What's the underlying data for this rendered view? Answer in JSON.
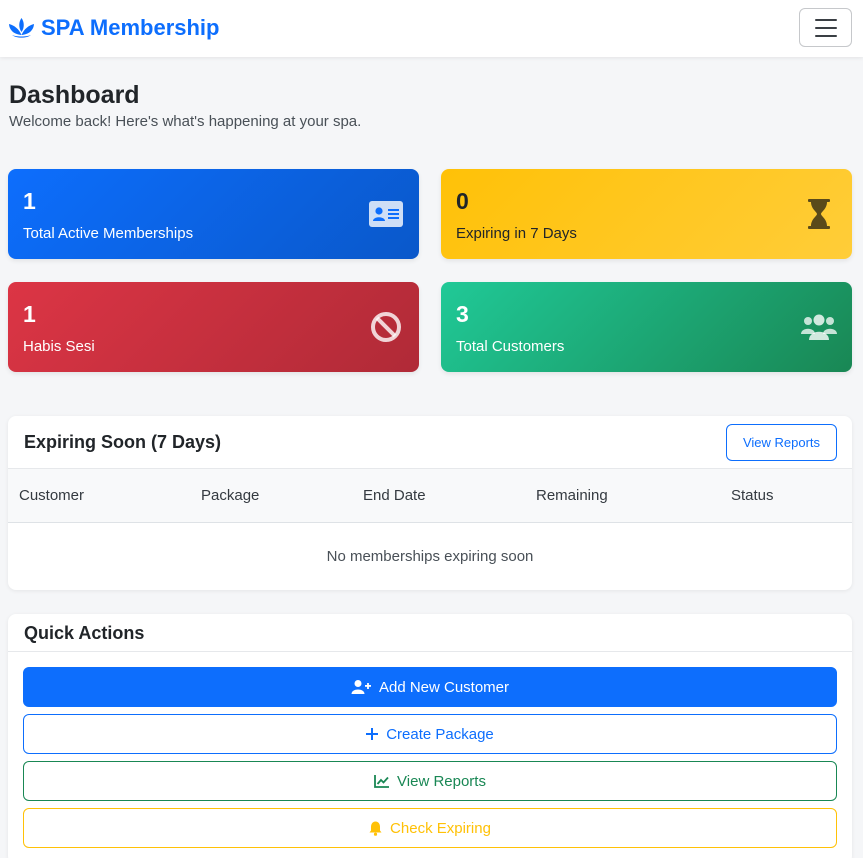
{
  "navbar": {
    "brand_label": "SPA Membership",
    "brand_icon": "spa-lotus-icon",
    "toggler_icon": "hamburger-menu-icon"
  },
  "header": {
    "title": "Dashboard",
    "subtitle": "Welcome back! Here's what's happening at your spa."
  },
  "stats": [
    {
      "value": "1",
      "label": "Total Active Memberships",
      "icon": "id-card-icon",
      "color": "#0d6efd"
    },
    {
      "value": "0",
      "label": "Expiring in 7 Days",
      "icon": "hourglass-icon",
      "color": "#ffc107"
    },
    {
      "value": "1",
      "label": "Habis Sesi",
      "icon": "ban-icon",
      "color": "#dc3545"
    },
    {
      "value": "3",
      "label": "Total Customers",
      "icon": "users-icon",
      "color": "#20c997"
    }
  ],
  "expiring": {
    "title": "Expiring Soon (7 Days)",
    "view_reports_label": "View Reports",
    "columns": [
      "Customer",
      "Package",
      "End Date",
      "Remaining",
      "Status"
    ],
    "empty_message": "No memberships expiring soon"
  },
  "quick_actions": {
    "title": "Quick Actions",
    "buttons": [
      {
        "label": "Add New Customer",
        "icon": "user-plus-icon",
        "color": "#0d6efd"
      },
      {
        "label": "Create Package",
        "icon": "plus-icon",
        "color": "#0d6efd"
      },
      {
        "label": "View Reports",
        "icon": "chart-line-icon",
        "color": "#198754"
      },
      {
        "label": "Check Expiring",
        "icon": "bell-icon",
        "color": "#ffc107"
      }
    ]
  }
}
